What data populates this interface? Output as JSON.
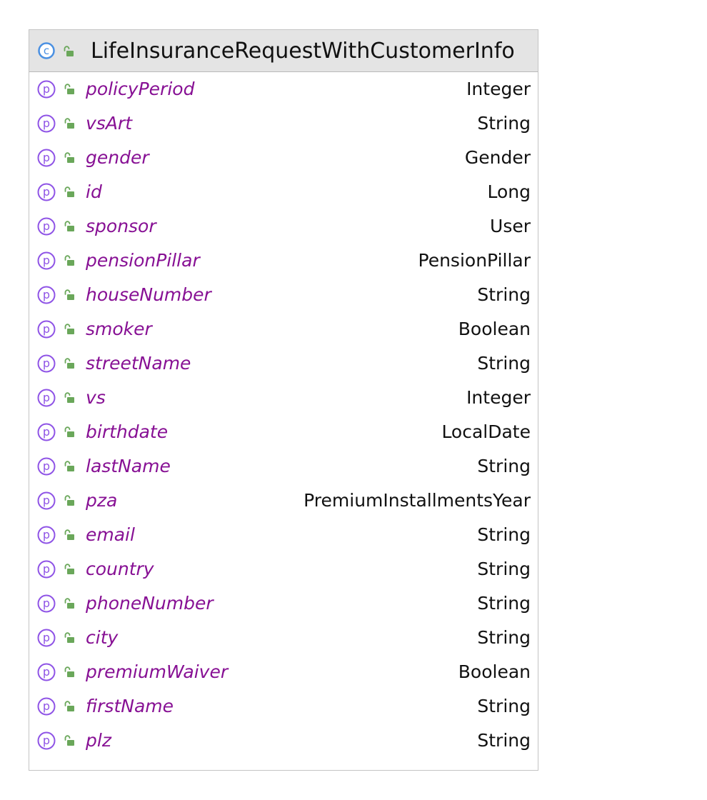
{
  "class_title": "LifeInsuranceRequestWithCustomerInfo",
  "class_badge_letter": "c",
  "property_badge_letter": "p",
  "icons": {
    "class_badge": "class-c-icon",
    "property_badge": "property-p-icon",
    "visibility": "public-unlocked-lock-icon"
  },
  "colors": {
    "header_bg": "#e4e4e4",
    "class_badge": "#4a90e2",
    "property_badge": "#8f54e6",
    "lock": "#6aa75a",
    "field_name": "#871094",
    "field_type": "#111111"
  },
  "fields": [
    {
      "name": "policyPeriod",
      "type": "Integer"
    },
    {
      "name": "vsArt",
      "type": "String"
    },
    {
      "name": "gender",
      "type": "Gender"
    },
    {
      "name": "id",
      "type": "Long"
    },
    {
      "name": "sponsor",
      "type": "User"
    },
    {
      "name": "pensionPillar",
      "type": "PensionPillar"
    },
    {
      "name": "houseNumber",
      "type": "String"
    },
    {
      "name": "smoker",
      "type": "Boolean"
    },
    {
      "name": "streetName",
      "type": "String"
    },
    {
      "name": "vs",
      "type": "Integer"
    },
    {
      "name": "birthdate",
      "type": "LocalDate"
    },
    {
      "name": "lastName",
      "type": "String"
    },
    {
      "name": "pza",
      "type": "PremiumInstallmentsYear"
    },
    {
      "name": "email",
      "type": "String"
    },
    {
      "name": "country",
      "type": "String"
    },
    {
      "name": "phoneNumber",
      "type": "String"
    },
    {
      "name": "city",
      "type": "String"
    },
    {
      "name": "premiumWaiver",
      "type": "Boolean"
    },
    {
      "name": "firstName",
      "type": "String"
    },
    {
      "name": "plz",
      "type": "String"
    }
  ]
}
